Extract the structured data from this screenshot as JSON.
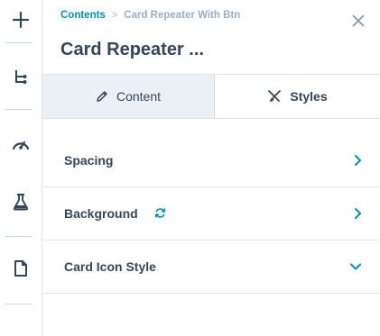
{
  "rail": {
    "items": [
      {
        "name": "add-icon"
      },
      {
        "name": "tree-icon"
      },
      {
        "name": "gauge-icon"
      },
      {
        "name": "flask-icon"
      },
      {
        "name": "document-icon"
      }
    ]
  },
  "breadcrumb": {
    "link": "Contents",
    "separator": ">",
    "current": "Card Repeater With Btn"
  },
  "header": {
    "title": "Card Repeater ..."
  },
  "tabs": [
    {
      "label": "Content",
      "icon": "pencil-icon",
      "active": false
    },
    {
      "label": "Styles",
      "icon": "brush-icon",
      "active": true
    }
  ],
  "sections": [
    {
      "label": "Spacing",
      "chevron": "chevron-right-icon"
    },
    {
      "label": "Background",
      "badge": "refresh-icon",
      "chevron": "chevron-right-icon"
    },
    {
      "label": "Card Icon Style",
      "chevron": "chevron-down-icon"
    }
  ],
  "colors": {
    "accent": "#0091ae",
    "text": "#33475b",
    "muted": "#99afc4",
    "border": "#dfe3eb",
    "tab_inactive_bg": "#eaf0f6"
  }
}
